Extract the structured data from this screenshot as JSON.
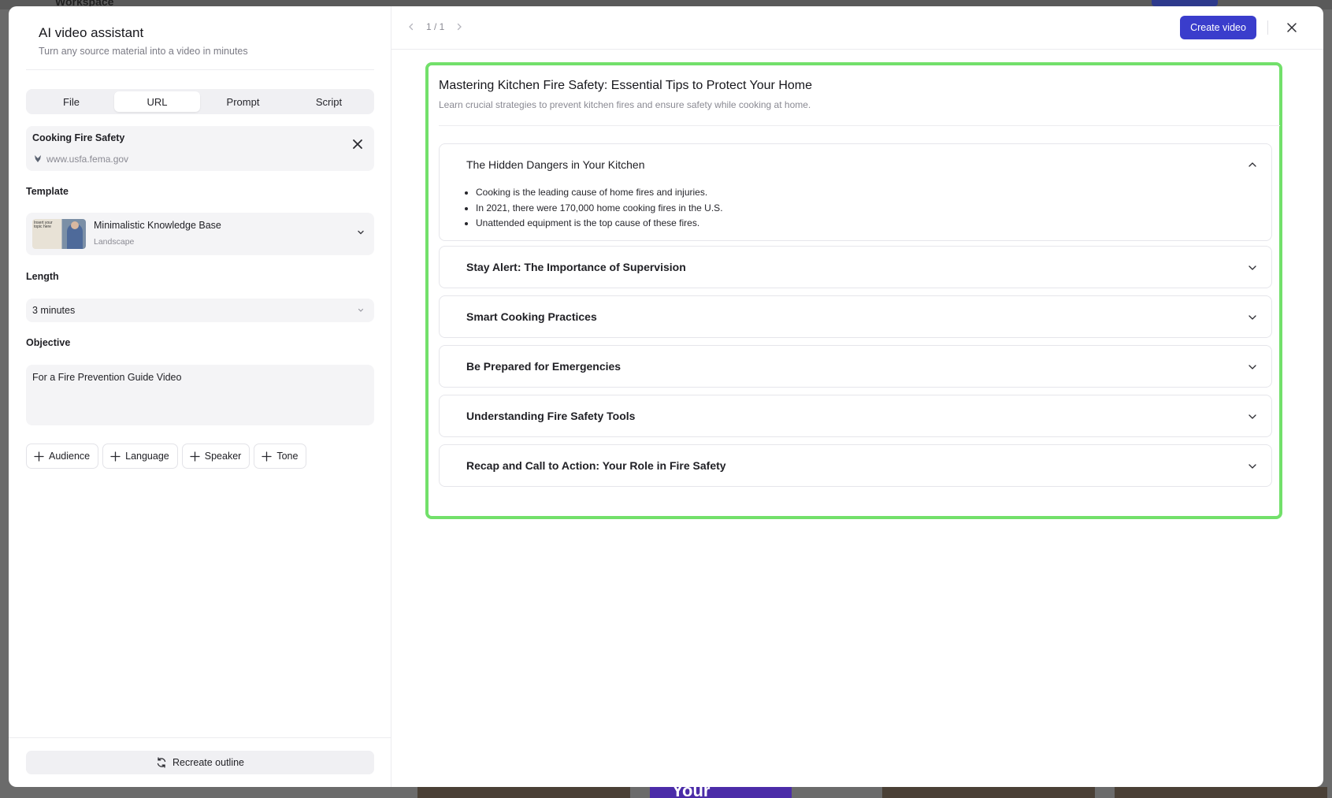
{
  "background": {
    "workspace_label": "Workspace",
    "thumb_text": "Your"
  },
  "colors": {
    "accent": "#3a3dcc",
    "highlight_border": "#72e06a"
  },
  "panel": {
    "title": "AI video assistant",
    "subtitle": "Turn any source material into a video in minutes",
    "tabs": [
      {
        "label": "File",
        "active": false
      },
      {
        "label": "URL",
        "active": true
      },
      {
        "label": "Prompt",
        "active": false
      },
      {
        "label": "Script",
        "active": false
      }
    ],
    "source": {
      "title": "Cooking Fire Safety",
      "url": "www.usfa.fema.gov",
      "icon": "favicon-icon",
      "remove_icon": "close-icon"
    },
    "template": {
      "label": "Template",
      "name": "Minimalistic Knowledge Base",
      "orientation": "Landscape",
      "thumb_text": "Insert your topic here"
    },
    "length": {
      "label": "Length",
      "value": "3 minutes"
    },
    "objective": {
      "label": "Objective",
      "value": "For a Fire Prevention Guide Video"
    },
    "chips": [
      "Audience",
      "Language",
      "Speaker",
      "Tone"
    ],
    "recreate_label": "Recreate outline"
  },
  "header": {
    "page_indicator": "1 / 1",
    "create_label": "Create video"
  },
  "outline": {
    "title": "Mastering Kitchen Fire Safety: Essential Tips to Protect Your Home",
    "subtitle": "Learn crucial strategies to prevent kitchen fires and ensure safety while cooking at home.",
    "sections": [
      {
        "title": "The Hidden Dangers in Your Kitchen",
        "expanded": true,
        "bullets": [
          "Cooking is the leading cause of home fires and injuries.",
          "In 2021, there were 170,000 home cooking fires in the U.S.",
          "Unattended equipment is the top cause of these fires."
        ]
      },
      {
        "title": "Stay Alert: The Importance of Supervision",
        "expanded": false
      },
      {
        "title": "Smart Cooking Practices",
        "expanded": false
      },
      {
        "title": "Be Prepared for Emergencies",
        "expanded": false
      },
      {
        "title": "Understanding Fire Safety Tools",
        "expanded": false
      },
      {
        "title": "Recap and Call to Action: Your Role in Fire Safety",
        "expanded": false
      }
    ]
  }
}
